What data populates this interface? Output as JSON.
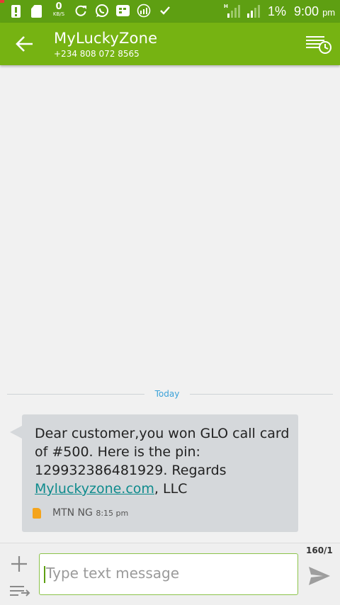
{
  "status_bar": {
    "speed_value": "0",
    "speed_unit": "KB/S",
    "battery": "1%",
    "time": "9:00",
    "ampm": "pm",
    "icons": [
      "alert-icon",
      "sd-card-icon",
      "refresh-icon",
      "whatsapp-icon",
      "bbm-icon",
      "chart-icon",
      "check-icon",
      "signal-h-icon",
      "signal-icon"
    ]
  },
  "header": {
    "title": "MyLuckyZone",
    "phone": "+234 808 072 8565",
    "back_icon": "back-arrow-icon",
    "schedule_icon": "scheduled-message-icon"
  },
  "conversation": {
    "date_label": "Today",
    "messages": [
      {
        "text": "Dear customer,you won GLO call card of #500. Here is the pin: 129932386481929. Regards ",
        "link": "Myluckyzone.com",
        "suffix": ", LLC",
        "sim": "MTN NG",
        "time": "8:15 pm"
      }
    ]
  },
  "composer": {
    "counter": "160/1",
    "placeholder": "Type text message"
  },
  "colors": {
    "status_bar": "#5e9f12",
    "app_bar": "#76b312",
    "bubble": "#d5d8db",
    "link": "#0f8b8d",
    "date_label": "#3aa1d8"
  }
}
